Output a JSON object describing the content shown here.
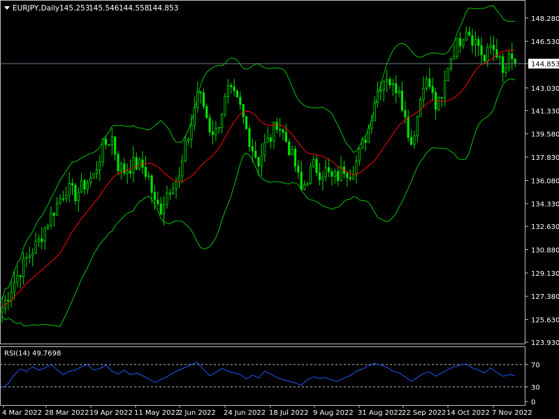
{
  "header": {
    "symbol_label": "EURJPY,Daily",
    "ohlc": [
      "145.253",
      "145.546",
      "144.558",
      "144.853"
    ]
  },
  "colors": {
    "background": "#000000",
    "frame": "#c0c0c0",
    "candles": "#00e000",
    "bands": "#00c800",
    "ma": "#ff0000",
    "rsi": "#1e5aff",
    "price_line": "#708090",
    "text": "#ffffff"
  },
  "chart_data": [
    {
      "type": "candlestick",
      "title": "EURJPY,Daily",
      "indicators": [
        "Bollinger Bands",
        "Moving Average"
      ],
      "x": [
        "4 Mar 2022",
        "28 Mar 2022",
        "19 Apr 2022",
        "11 May 2022",
        "2 Jun 2022",
        "24 Jun 2022",
        "18 Jul 2022",
        "9 Aug 2022",
        "31 Aug 2022",
        "22 Sep 2022",
        "14 Oct 2022",
        "7 Nov 2022"
      ],
      "y_ticks": [
        "148.280",
        "146.530",
        "144.853",
        "143.030",
        "141.330",
        "139.580",
        "137.830",
        "136.080",
        "134.330",
        "132.630",
        "130.880",
        "129.130",
        "127.380",
        "125.630",
        "123.930"
      ],
      "ylim": [
        123.93,
        148.9
      ],
      "last_price": 144.853,
      "close_series": [
        [
          0,
          126.5
        ],
        [
          4,
          128.5
        ],
        [
          8,
          130.2
        ],
        [
          12,
          131.5
        ],
        [
          15,
          133.0
        ],
        [
          18,
          134.3
        ],
        [
          21,
          135.5
        ],
        [
          24,
          135.0
        ],
        [
          27,
          135.8
        ],
        [
          30,
          136.4
        ],
        [
          33,
          138.6
        ],
        [
          36,
          139.3
        ],
        [
          38,
          137.2
        ],
        [
          40,
          136.8
        ],
        [
          43,
          137.3
        ],
        [
          46,
          137.1
        ],
        [
          48,
          136.3
        ],
        [
          50,
          134.3
        ],
        [
          52,
          134.0
        ],
        [
          54,
          135.2
        ],
        [
          56,
          136.0
        ],
        [
          58,
          136.2
        ],
        [
          60,
          138.5
        ],
        [
          62,
          140.3
        ],
        [
          64,
          142.8
        ],
        [
          66,
          141.7
        ],
        [
          68,
          140.0
        ],
        [
          70,
          139.7
        ],
        [
          72,
          141.3
        ],
        [
          74,
          142.8
        ],
        [
          76,
          142.3
        ],
        [
          78,
          141.5
        ],
        [
          80,
          139.9
        ],
        [
          82,
          138.5
        ],
        [
          84,
          137.5
        ],
        [
          86,
          138.7
        ],
        [
          88,
          139.3
        ],
        [
          90,
          140.5
        ],
        [
          92,
          139.6
        ],
        [
          94,
          138.5
        ],
        [
          96,
          137.2
        ],
        [
          98,
          135.3
        ],
        [
          100,
          136.3
        ],
        [
          102,
          137.2
        ],
        [
          104,
          136.7
        ],
        [
          106,
          136.8
        ],
        [
          108,
          136.2
        ],
        [
          110,
          136.4
        ],
        [
          112,
          137.0
        ],
        [
          114,
          136.7
        ],
        [
          116,
          137.5
        ],
        [
          118,
          138.7
        ],
        [
          120,
          140.0
        ],
        [
          122,
          142.2
        ],
        [
          124,
          143.4
        ],
        [
          126,
          144.0
        ],
        [
          128,
          143.0
        ],
        [
          130,
          143.2
        ],
        [
          132,
          140.7
        ],
        [
          134,
          138.9
        ],
        [
          136,
          140.9
        ],
        [
          138,
          143.6
        ],
        [
          140,
          143.2
        ],
        [
          142,
          141.6
        ],
        [
          144,
          142.0
        ],
        [
          146,
          144.8
        ],
        [
          148,
          145.9
        ],
        [
          150,
          146.7
        ],
        [
          152,
          147.6
        ],
        [
          154,
          146.8
        ],
        [
          156,
          146.3
        ],
        [
          158,
          145.0
        ],
        [
          160,
          146.2
        ],
        [
          162,
          145.8
        ],
        [
          164,
          144.0
        ],
        [
          166,
          145.1
        ],
        [
          168,
          144.9
        ]
      ]
    },
    {
      "type": "line",
      "title": "RSI(14) 49.7698",
      "y_ticks": [
        "70",
        "30",
        "0"
      ],
      "ylim": [
        0,
        100
      ],
      "levels": [
        70,
        30
      ],
      "series": [
        {
          "values": [
            [
              0,
              28
            ],
            [
              2,
              36
            ],
            [
              4,
              52
            ],
            [
              6,
              62
            ],
            [
              8,
              58
            ],
            [
              10,
              66
            ],
            [
              12,
              60
            ],
            [
              14,
              64
            ],
            [
              16,
              70
            ],
            [
              18,
              61
            ],
            [
              20,
              52
            ],
            [
              22,
              58
            ],
            [
              24,
              60
            ],
            [
              26,
              66
            ],
            [
              28,
              70
            ],
            [
              30,
              60
            ],
            [
              32,
              63
            ],
            [
              34,
              69
            ],
            [
              36,
              58
            ],
            [
              38,
              53
            ],
            [
              40,
              60
            ],
            [
              42,
              52
            ],
            [
              44,
              55
            ],
            [
              46,
              50
            ],
            [
              48,
              44
            ],
            [
              50,
              38
            ],
            [
              52,
              43
            ],
            [
              54,
              48
            ],
            [
              56,
              55
            ],
            [
              58,
              60
            ],
            [
              60,
              65
            ],
            [
              62,
              70
            ],
            [
              64,
              74
            ],
            [
              66,
              61
            ],
            [
              68,
              50
            ],
            [
              70,
              56
            ],
            [
              72,
              63
            ],
            [
              74,
              58
            ],
            [
              76,
              55
            ],
            [
              78,
              52
            ],
            [
              80,
              44
            ],
            [
              82,
              51
            ],
            [
              84,
              46
            ],
            [
              86,
              58
            ],
            [
              88,
              53
            ],
            [
              90,
              47
            ],
            [
              92,
              43
            ],
            [
              94,
              40
            ],
            [
              96,
              37
            ],
            [
              98,
              33
            ],
            [
              100,
              43
            ],
            [
              102,
              48
            ],
            [
              104,
              45
            ],
            [
              106,
              47
            ],
            [
              108,
              42
            ],
            [
              110,
              40
            ],
            [
              112,
              46
            ],
            [
              114,
              50
            ],
            [
              116,
              58
            ],
            [
              118,
              62
            ],
            [
              120,
              68
            ],
            [
              122,
              72
            ],
            [
              124,
              69
            ],
            [
              126,
              65
            ],
            [
              128,
              58
            ],
            [
              130,
              55
            ],
            [
              132,
              48
            ],
            [
              134,
              40
            ],
            [
              136,
              47
            ],
            [
              138,
              54
            ],
            [
              140,
              57
            ],
            [
              142,
              49
            ],
            [
              144,
              55
            ],
            [
              146,
              61
            ],
            [
              148,
              66
            ],
            [
              150,
              69
            ],
            [
              152,
              71
            ],
            [
              154,
              64
            ],
            [
              156,
              60
            ],
            [
              158,
              55
            ],
            [
              160,
              64
            ],
            [
              162,
              56
            ],
            [
              164,
              49
            ],
            [
              166,
              52
            ],
            [
              168,
              50
            ]
          ]
        }
      ]
    }
  ]
}
